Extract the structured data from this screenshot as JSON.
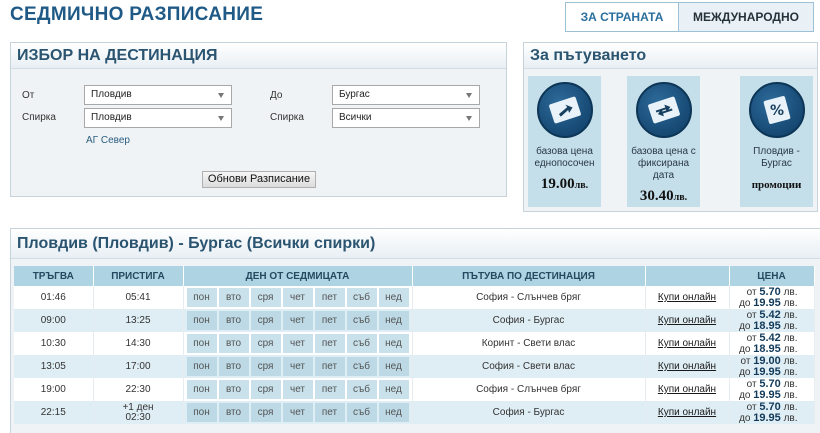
{
  "header": {
    "title": "СЕДМИЧНО РАЗПИСАНИЕ",
    "tabs": [
      {
        "label": "ЗА СТРАНАТА",
        "active": true
      },
      {
        "label": "МЕЖДУНАРОДНО",
        "active": false
      }
    ]
  },
  "destination": {
    "title": "ИЗБОР НА ДЕСТИНАЦИЯ",
    "from_label": "От",
    "from_value": "Пловдив",
    "to_label": "До",
    "to_value": "Бургас",
    "from_stop_label": "Спирка",
    "from_stop_value": "Пловдив",
    "to_stop_label": "Спирка",
    "to_stop_value": "Всички",
    "stop_note": "АГ Север",
    "refresh_label": "Обнови Разписание"
  },
  "trip": {
    "title": "За пътуването",
    "cards": [
      {
        "label": "базова цена еднопосочен",
        "price": "19.00",
        "unit": "лв.",
        "icon": "ticket-arrow-icon"
      },
      {
        "label": "базова цена с фиксирана дата",
        "price": "30.40",
        "unit": "лв.",
        "icon": "ticket-return-icon"
      },
      {
        "label": "Пловдив - Бургас",
        "promo": "промоции",
        "icon": "ticket-percent-icon"
      }
    ]
  },
  "schedule": {
    "title": "Пловдив (Пловдив) - Бургас (Всички спирки)",
    "columns": [
      "ТРЪГВА",
      "ПРИСТИГА",
      "ДЕН ОТ СЕДМИЦАТА",
      "ПЪТУВА ПО ДЕСТИНАЦИЯ",
      "",
      "ЦЕНА"
    ],
    "days": [
      "пон",
      "вто",
      "сря",
      "чет",
      "пет",
      "съб",
      "нед"
    ],
    "buy_label": "Купи онлайн",
    "price_from_prefix": "от",
    "price_to_prefix": "до",
    "currency": "лв.",
    "rows": [
      {
        "depart": "01:46",
        "arrive": "05:41",
        "arrive_extra": "",
        "route": "София - Слънчев бряг",
        "price_from": "5.70",
        "price_to": "19.95"
      },
      {
        "depart": "09:00",
        "arrive": "13:25",
        "arrive_extra": "",
        "route": "София - Бургас",
        "price_from": "5.42",
        "price_to": "18.95"
      },
      {
        "depart": "10:30",
        "arrive": "14:30",
        "arrive_extra": "",
        "route": "Коринт - Свети влас",
        "price_from": "5.42",
        "price_to": "18.95"
      },
      {
        "depart": "13:05",
        "arrive": "17:00",
        "arrive_extra": "",
        "route": "София - Свети влас",
        "price_from": "19.00",
        "price_to": "19.95"
      },
      {
        "depart": "19:00",
        "arrive": "22:30",
        "arrive_extra": "",
        "route": "София - Слънчев бряг",
        "price_from": "5.70",
        "price_to": "19.95"
      },
      {
        "depart": "22:15",
        "arrive": "02:30",
        "arrive_extra": "+1 ден",
        "route": "София - Бургас",
        "price_from": "5.70",
        "price_to": "19.95"
      }
    ]
  }
}
